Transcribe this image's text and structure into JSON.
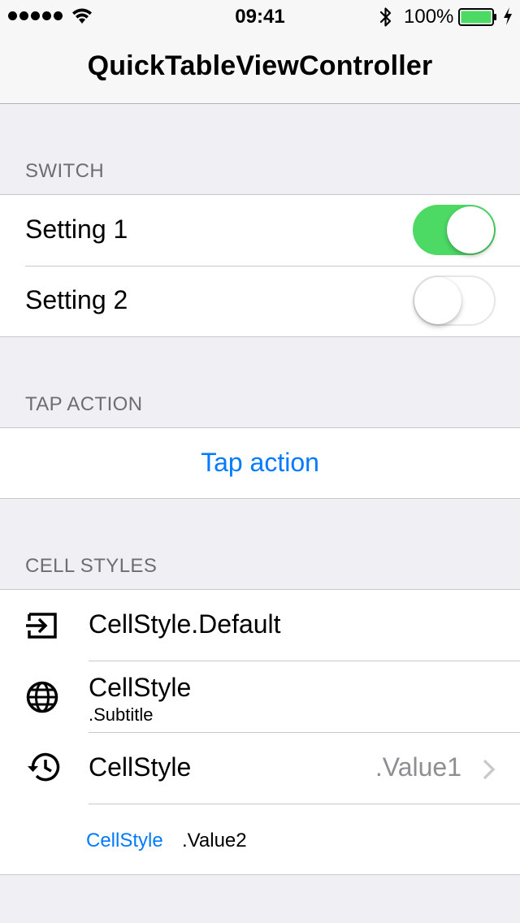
{
  "status_bar": {
    "time": "09:41",
    "battery_percent": "100%",
    "signal_bars": 5,
    "icons": [
      "signal-dots-icon",
      "wifi-icon",
      "bluetooth-icon",
      "battery-icon",
      "charging-bolt-icon"
    ]
  },
  "nav": {
    "title": "QuickTableViewController"
  },
  "sections": {
    "switch": {
      "header": "SWITCH",
      "rows": [
        {
          "label": "Setting 1",
          "on": true
        },
        {
          "label": "Setting 2",
          "on": false
        }
      ]
    },
    "tap_action": {
      "header": "TAP ACTION",
      "button_label": "Tap action"
    },
    "cell_styles": {
      "header": "CELL STYLES",
      "rows": [
        {
          "title": "CellStyle.Default",
          "icon": "exit-icon"
        },
        {
          "title": "CellStyle",
          "subtitle": ".Subtitle",
          "icon": "globe-icon"
        },
        {
          "title": "CellStyle",
          "detail": ".Value1",
          "icon": "history-icon",
          "accessory": "chevron-right-icon"
        },
        {
          "title": "CellStyle",
          "detail": ".Value2"
        }
      ]
    }
  },
  "colors": {
    "accent": "#007aff",
    "switch_on": "#4cd964",
    "background": "#efeff4",
    "header_text": "#6d6d72",
    "detail_text": "#8e8e93",
    "separator": "#c8c7cc"
  }
}
